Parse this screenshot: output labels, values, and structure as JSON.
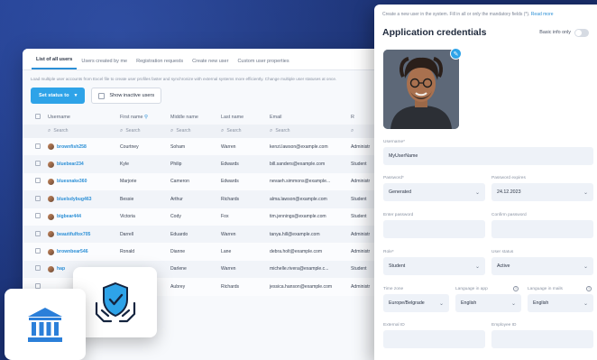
{
  "list": {
    "tabs": [
      "List of all users",
      "Users created by me",
      "Registration requests",
      "Create new user",
      "Custom user properties"
    ],
    "intro": "Load multiple user accounts from Excel file to create user profiles faster and synchronize with external systems more efficiently. Change multiple user statuses at once.",
    "set_status_label": "Set status to",
    "show_inactive_label": "Show inactive users",
    "columns": [
      "Username",
      "First name",
      "Middle name",
      "Last name",
      "Email",
      "R"
    ],
    "search_label": "Search",
    "rows": [
      {
        "username": "brownfish258",
        "first": "Courtney",
        "middle": "Soham",
        "last": "Warren",
        "email": "kenzi.lawson@example.com",
        "role": "Administr"
      },
      {
        "username": "bluebear234",
        "first": "Kyle",
        "middle": "Philip",
        "last": "Edwards",
        "email": "bill.sanders@example.com",
        "role": "Student"
      },
      {
        "username": "bluesnake360",
        "first": "Marjorie",
        "middle": "Cameron",
        "last": "Edwards",
        "email": "nevaeh.simmons@example...",
        "role": "Administr"
      },
      {
        "username": "bluelsdybug463",
        "first": "Bessie",
        "middle": "Arthur",
        "last": "Richards",
        "email": "alma.lawson@example.com",
        "role": "Student"
      },
      {
        "username": "bigbear444",
        "first": "Victoria",
        "middle": "Cody",
        "last": "Fox",
        "email": "tim.jennings@example.com",
        "role": "Student"
      },
      {
        "username": "beautifulfox705",
        "first": "Darrell",
        "middle": "Eduardo",
        "last": "Warren",
        "email": "tanya.hill@example.com",
        "role": "Administr"
      },
      {
        "username": "brownbear546",
        "first": "Ronald",
        "middle": "Dianne",
        "last": "Lane",
        "email": "debra.holt@example.com",
        "role": "Administr"
      },
      {
        "username": "hap",
        "first": "",
        "middle": "Darlene",
        "last": "Warren",
        "email": "michelle.rivera@example.c...",
        "role": "Student"
      },
      {
        "username": "",
        "first": "",
        "middle": "Aubrey",
        "last": "Richards",
        "email": "jessica.hanson@example.com",
        "role": "Administr"
      }
    ]
  },
  "cred": {
    "note": "Create a new user in the system. Fill in all or only the mandatory fields (*).",
    "note_more": "Read more",
    "title": "Application credentials",
    "basic_info_label": "Basic info only",
    "username_label": "Username*",
    "username_value": "MyUserName",
    "password_label": "Password*",
    "password_value": "Generated",
    "expires_label": "Password expires",
    "expires_value": "24.12.2023",
    "enter_pw_label": "Enter password",
    "confirm_pw_label": "Confirm password",
    "role_label": "Role*",
    "role_value": "Student",
    "status_label": "User status",
    "status_value": "Active",
    "timezone_label": "Time zone",
    "timezone_value": "Europe/Belgrade",
    "lang_app_label": "Language in app",
    "lang_app_value": "English",
    "lang_mails_label": "Language in mails",
    "lang_mails_value": "English",
    "external_label": "External ID",
    "employee_label": "Employee ID"
  },
  "colors": {
    "accent": "#2ea3e8",
    "link": "#2b8fd6",
    "background": "#1f3a8a"
  }
}
